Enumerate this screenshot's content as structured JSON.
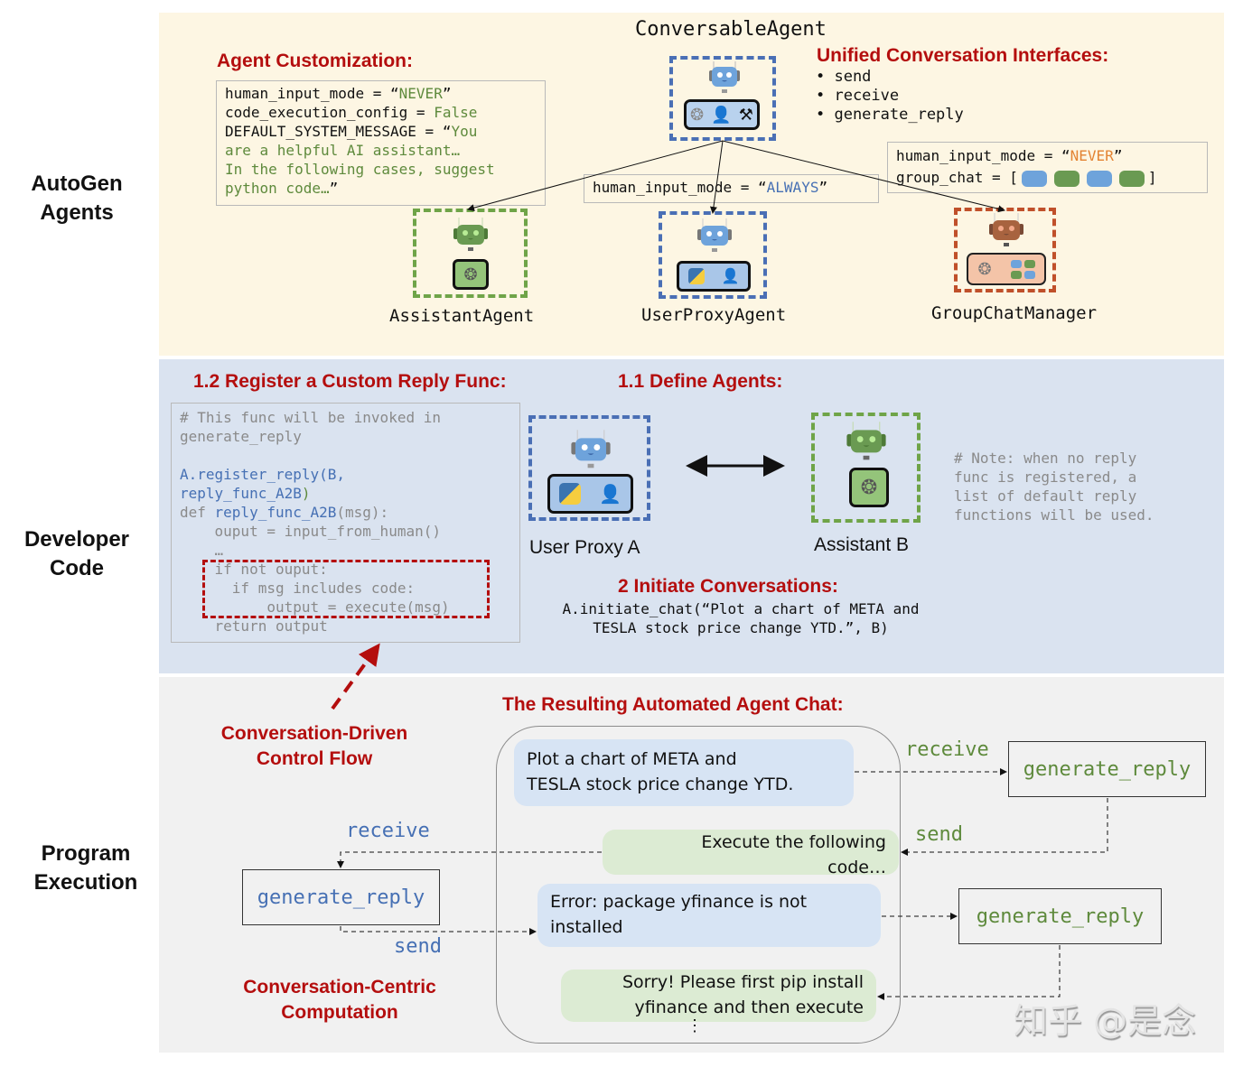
{
  "row_labels": {
    "agents": [
      "AutoGen",
      "Agents"
    ],
    "developer": [
      "Developer",
      "Code"
    ],
    "execution": [
      "Program",
      "Execution"
    ]
  },
  "colors": {
    "agents_bg": "#fdf6e3",
    "developer_bg": "#dae3f0",
    "execution_bg": "#f1f1f1",
    "title_red": "#b40e0e",
    "agent_blue": "#4670b4",
    "agent_green": "#6fa448",
    "agent_orange": "#c0502a"
  },
  "agents_section": {
    "customization_title": "Agent Customization:",
    "customization_code": [
      {
        "parts": [
          {
            "t": "human_input_mode = “",
            "c": ""
          },
          {
            "t": "NEVER",
            "c": "green"
          },
          {
            "t": "”",
            "c": ""
          }
        ]
      },
      {
        "parts": [
          {
            "t": "code_execution_config = ",
            "c": ""
          },
          {
            "t": "False",
            "c": "green"
          }
        ]
      },
      {
        "parts": [
          {
            "t": "DEFAULT_SYSTEM_MESSAGE = “",
            "c": ""
          },
          {
            "t": "You",
            "c": "green"
          }
        ]
      },
      {
        "parts": [
          {
            "t": "are a helpful AI assistant…",
            "c": "green"
          }
        ]
      },
      {
        "parts": [
          {
            "t": "In the following cases, suggest",
            "c": "green"
          }
        ]
      },
      {
        "parts": [
          {
            "t": "python code…",
            "c": "green"
          },
          {
            "t": "”",
            "c": ""
          }
        ]
      }
    ],
    "conversable_agent_label": "ConversableAgent",
    "interfaces_title": "Unified Conversation Interfaces:",
    "interfaces": [
      "send",
      "receive",
      "generate_reply"
    ],
    "userproxy_config": {
      "prefix": "human_input_mode = “",
      "value": "ALWAYS",
      "suffix": "”"
    },
    "groupchat_config": {
      "line1_prefix": "human_input_mode = “",
      "line1_value": "NEVER",
      "line1_suffix": "”",
      "line2_prefix": "group_chat = [",
      "line2_suffix": "]"
    },
    "agents": [
      {
        "name": "AssistantAgent",
        "color": "green",
        "tools": [
          "openai-icon"
        ]
      },
      {
        "name": "UserProxyAgent",
        "color": "blue",
        "tools": [
          "python-icon",
          "human-icon"
        ]
      },
      {
        "name": "GroupChatManager",
        "color": "orange",
        "tools": [
          "openai-icon",
          "agent-grid-icon"
        ]
      }
    ]
  },
  "developer_section": {
    "register_title": "1.2 Register a Custom Reply Func:",
    "register_code": [
      {
        "parts": [
          {
            "t": "# This func will be invoked in",
            "c": "gray"
          }
        ]
      },
      {
        "parts": [
          {
            "t": "generate_reply",
            "c": "gray"
          }
        ]
      },
      {
        "parts": [
          {
            "t": "",
            "c": ""
          }
        ]
      },
      {
        "parts": [
          {
            "t": "A.register_reply(B,",
            "c": "blue"
          }
        ]
      },
      {
        "parts": [
          {
            "t": "reply_func_A2B",
            "c": "blue"
          },
          {
            "t": ")",
            "c": "green"
          }
        ]
      },
      {
        "parts": [
          {
            "t": "def ",
            "c": "gray"
          },
          {
            "t": "reply_func_A2B",
            "c": "blue"
          },
          {
            "t": "(msg):",
            "c": "gray"
          }
        ]
      },
      {
        "parts": [
          {
            "t": "    ouput = input_from_human()",
            "c": "gray"
          }
        ]
      },
      {
        "parts": [
          {
            "t": "    …",
            "c": "gray"
          }
        ]
      },
      {
        "parts": [
          {
            "t": "    if not ouput:",
            "c": "gray"
          }
        ]
      },
      {
        "parts": [
          {
            "t": "      if msg includes code:",
            "c": "gray"
          }
        ]
      },
      {
        "parts": [
          {
            "t": "          output = execute(msg)",
            "c": "gray"
          }
        ]
      },
      {
        "parts": [
          {
            "t": "    return output",
            "c": "gray"
          }
        ]
      }
    ],
    "define_title": "1.1 Define Agents:",
    "agent_a_label": "User Proxy A",
    "agent_b_label": "Assistant B",
    "note": [
      "# Note: when no reply",
      "func is registered, a",
      "list of default reply",
      "functions will be used."
    ],
    "initiate_title": "2 Initiate Conversations:",
    "initiate_code": [
      "A.initiate_chat(“Plot a chart of META and",
      "TESLA stock price change YTD.”, B)"
    ]
  },
  "execution_section": {
    "control_flow_label": [
      "Conversation-Driven",
      "Control Flow"
    ],
    "computation_label": [
      "Conversation-Centric",
      "Computation"
    ],
    "chat_title": "The Resulting Automated Agent Chat:",
    "messages": [
      {
        "text": [
          "Plot a chart of META and",
          "TESLA stock price change YTD."
        ],
        "side": "user"
      },
      {
        "text": [
          "Execute the following",
          "code…"
        ],
        "side": "assistant"
      },
      {
        "text": [
          "Error: package yfinance is not",
          "installed"
        ],
        "side": "user"
      },
      {
        "text": [
          "Sorry! Please first pip install",
          "yfinance and then execute"
        ],
        "side": "assistant"
      }
    ],
    "ellipsis": "⋮",
    "left_receive": "receive",
    "left_send": "send",
    "left_generate": "generate_reply",
    "right_receive": "receive",
    "right_send": "send",
    "right_generate_1": "generate_reply",
    "right_generate_2": "generate_reply"
  },
  "watermark": "知乎 @是念"
}
